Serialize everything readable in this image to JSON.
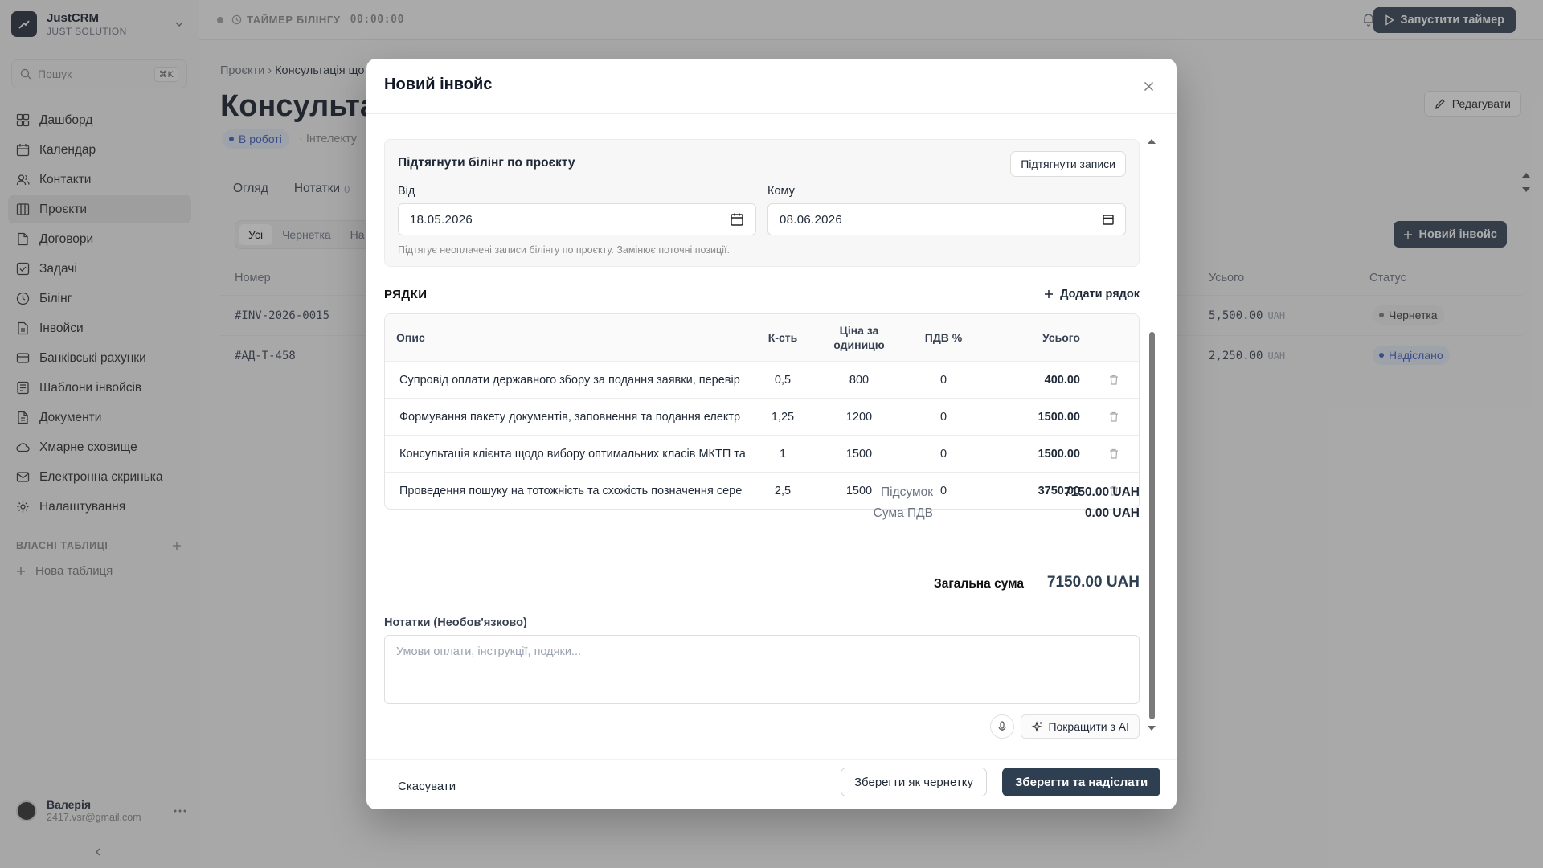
{
  "app": {
    "name": "JustCRM",
    "org": "JUST SOLUTION"
  },
  "search": {
    "placeholder": "Пошук",
    "shortcut": "⌘K"
  },
  "nav": [
    {
      "label": "Дашборд",
      "icon": "dashboard-icon"
    },
    {
      "label": "Календар",
      "icon": "calendar-icon"
    },
    {
      "label": "Контакти",
      "icon": "contacts-icon"
    },
    {
      "label": "Проєкти",
      "icon": "projects-icon",
      "active": true
    },
    {
      "label": "Договори",
      "icon": "contracts-icon"
    },
    {
      "label": "Задачі",
      "icon": "tasks-icon"
    },
    {
      "label": "Білінг",
      "icon": "billing-clock-icon"
    },
    {
      "label": "Інвойси",
      "icon": "invoices-icon"
    },
    {
      "label": "Банківські рахунки",
      "icon": "bank-accounts-icon"
    },
    {
      "label": "Шаблони інвойсів",
      "icon": "invoice-templates-icon"
    },
    {
      "label": "Документи",
      "icon": "documents-icon"
    },
    {
      "label": "Хмарне сховище",
      "icon": "cloud-icon"
    },
    {
      "label": "Електронна скринька",
      "icon": "mail-icon"
    },
    {
      "label": "Налаштування",
      "icon": "settings-icon"
    }
  ],
  "own_tables": {
    "label": "ВЛАСНІ ТАБЛИЦІ",
    "new_table": "Нова таблиця"
  },
  "user": {
    "name": "Валерія",
    "email": "2417.vsr@gmail.com"
  },
  "topbar": {
    "timer_label": "ТАЙМЕР БІЛІНГУ",
    "timer_value": "00:00:00",
    "start_button": "Запустити таймер"
  },
  "page": {
    "breadcrumb_root": "Проєкти",
    "breadcrumb_current": "Консультація що",
    "title": "Консультац",
    "status": "В роботі",
    "meta": "· Інтелекту",
    "edit_button": "Редагувати",
    "tabs": [
      {
        "label": "Огляд"
      },
      {
        "label": "Нотатки",
        "count": "0"
      }
    ],
    "filters": [
      "Усі",
      "Чернетка",
      "На"
    ],
    "new_invoice_button": "Новий інвойс",
    "columns": {
      "number": "Номер",
      "total": "Усього",
      "status": "Статус"
    },
    "invoices": [
      {
        "number": "#INV-2026-0015",
        "total": "5,500.00",
        "currency": "UAH",
        "status": "Чернетка"
      },
      {
        "number": "#АД-Т-458",
        "total": "2,250.00",
        "currency": "UAH",
        "status": "Надіслано"
      }
    ]
  },
  "modal": {
    "title": "Новий інвойс",
    "pull": {
      "title": "Підтягнути білінг по проєкту",
      "button": "Підтягнути записи",
      "from_label": "Від",
      "from_value": "18.05.2026",
      "to_label": "Кому",
      "to_value": "08.06.2026",
      "hint": "Підтягує неоплачені записи білінгу по проєкту. Замінює поточні позиції."
    },
    "lines_heading": "РЯДКИ",
    "add_line": "Додати рядок",
    "columns": {
      "desc": "Опис",
      "qty": "К-сть",
      "price": "Ціна за одиницю",
      "vat": "ПДВ %",
      "total": "Усього"
    },
    "lines": [
      {
        "desc": "Супровід оплати державного збору за подання заявки, перевір",
        "qty": "0,5",
        "price": "800",
        "vat": "0",
        "total": "400.00"
      },
      {
        "desc": "Формування пакету документів, заповнення та подання електр",
        "qty": "1,25",
        "price": "1200",
        "vat": "0",
        "total": "1500.00"
      },
      {
        "desc": "Консультація клієнта щодо вибору оптимальних класів МКТП та",
        "qty": "1",
        "price": "1500",
        "vat": "0",
        "total": "1500.00"
      },
      {
        "desc": "Проведення пошуку на тотожність та схожість позначення сере",
        "qty": "2,5",
        "price": "1500",
        "vat": "0",
        "total": "3750.00"
      }
    ],
    "subtotal_label": "Підсумок",
    "subtotal_value": "7150.00 UAH",
    "vat_label": "Сума ПДВ",
    "vat_value": "0.00 UAH",
    "grand_label": "Загальна сума",
    "grand_value": "7150.00 UAH",
    "notes_label": "Нотатки (Необов'язково)",
    "notes_placeholder": "Умови оплати, інструкції, подяки...",
    "ai_button": "Покращити з AI",
    "cancel": "Скасувати",
    "save_draft": "Зберегти як чернетку",
    "save_send": "Зберегти та надіслати"
  },
  "colors": {
    "primary": "#2f3f52",
    "accent_blue": "#3b5bbf"
  }
}
